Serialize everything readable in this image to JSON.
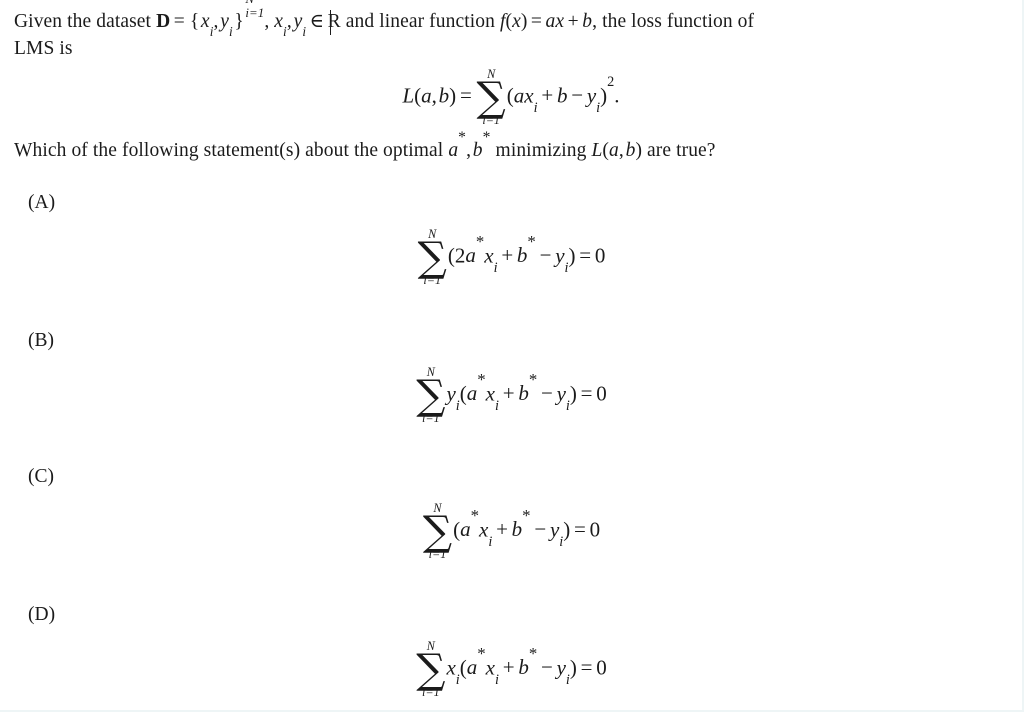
{
  "document": {
    "intro": {
      "text_parts": [
        "Given the dataset ",
        "D = {x",
        "i",
        ", y",
        "i",
        "}",
        "N",
        "i=1",
        ", x",
        "i",
        ", y",
        "i",
        " ∈ ℝ and linear function ",
        "f(x) = ax + b",
        ", the loss function of LMS is"
      ],
      "plain": "Given the dataset D = {x_i, y_i}_{i=1}^N, x_i, y_i ∈ R and linear function f(x) = ax + b, the loss function of LMS is",
      "lead": "Given the dataset",
      "dataset_symbol": "D",
      "equals": "=",
      "brace_open": "{",
      "brace_close": "}",
      "x_var": "x",
      "y_var": "y",
      "index": "i",
      "upper_limit": "N",
      "lower_limit": "i=1",
      "comma": ",",
      "member_symbol": "∈",
      "reals_symbol": "R",
      "mid_text": "and linear function",
      "function_name": "f",
      "function_arg": "x",
      "slope": "a",
      "plus": "+",
      "intercept": "b",
      "tail_text": ", the loss function of",
      "second_line": "LMS is"
    },
    "loss_equation": {
      "lhs_name": "L",
      "lhs_args": "(a, b)",
      "equals": "=",
      "sum_upper": "N",
      "sum_lower": "i=1",
      "sigma": "∑",
      "body": "(ax",
      "index": "i",
      "plus": "+",
      "intercept": "b",
      "minus": "−",
      "y_var": "y",
      "close_power": ")",
      "power": "2",
      "period": ".",
      "plain": "L(a, b) = ∑_{i=1}^{N} (ax_i + b − y_i)²."
    },
    "question": {
      "prefix": "Which of the following statement(s) about the optimal",
      "a_star": "a*",
      "comma": ",",
      "b_star": "b*",
      "middle": "minimizing",
      "loss_symbol": "L(a, b)",
      "suffix": "are true?",
      "plain": "Which of the following statement(s) about the optimal a*, b* minimizing L(a, b) are true?"
    },
    "choices": [
      {
        "label": "(A)",
        "leading_factor": "",
        "coefficient": "2",
        "plain": "∑_{i=1}^{N} (2a*x_i + b* − y_i) = 0",
        "sum_upper": "N",
        "sum_lower": "i=1",
        "result": "0"
      },
      {
        "label": "(B)",
        "leading_factor": "y",
        "coefficient": "",
        "plain": "∑_{i=1}^{N} y_i(a*x_i + b* − y_i) = 0",
        "sum_upper": "N",
        "sum_lower": "i=1",
        "result": "0"
      },
      {
        "label": "(C)",
        "leading_factor": "",
        "coefficient": "",
        "plain": "∑_{i=1}^{N} (a*x_i + b* − y_i) = 0",
        "sum_upper": "N",
        "sum_lower": "i=1",
        "result": "0"
      },
      {
        "label": "(D)",
        "leading_factor": "x",
        "coefficient": "",
        "plain": "∑_{i=1}^{N} x_i(a*x_i + b* − y_i) = 0",
        "sum_upper": "N",
        "sum_lower": "i=1",
        "result": "0"
      }
    ],
    "symbols": {
      "sigma": "∑",
      "equals": "=",
      "plus": "+",
      "minus": "−",
      "star": "*",
      "paren_open": "(",
      "paren_close": ")",
      "index": "i",
      "a": "a",
      "b": "b",
      "x": "x",
      "y": "y",
      "N": "N",
      "zero": "0",
      "two": "2"
    },
    "colors": {
      "background": "#ffffff",
      "text": "#1b1b1b",
      "edge": "#eef5f6"
    }
  }
}
